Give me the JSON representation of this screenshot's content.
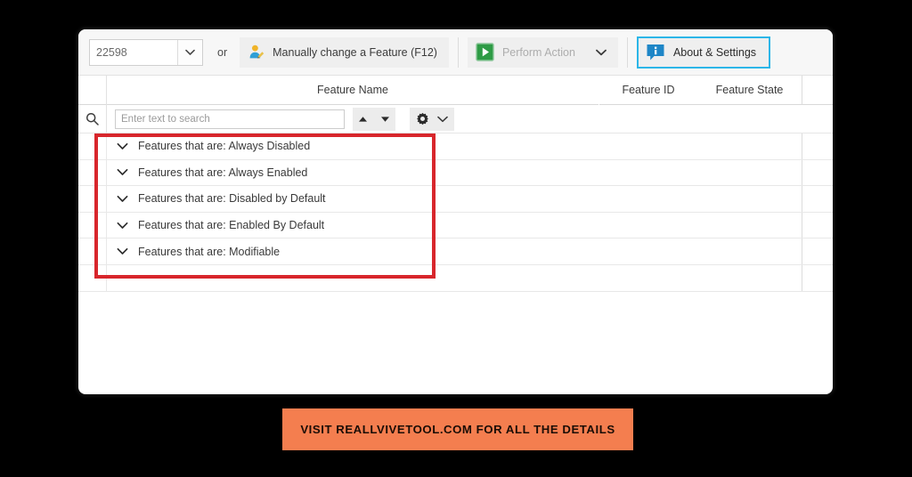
{
  "window": {
    "toolbar": {
      "build_combo": {
        "value": "22598",
        "icon": "chevron-down-icon"
      },
      "or_label": "or",
      "manual_change_button": {
        "label": "Manually change a Feature (F12)",
        "icon": "user-edit-icon"
      },
      "perform_action_button": {
        "label": "Perform Action",
        "icon": "play-icon",
        "dropdown_icon": "chevron-down-icon",
        "state": "disabled"
      },
      "about_settings_button": {
        "label": "About & Settings",
        "icon": "info-bubble-icon",
        "highlight_color": "#2cb6e8"
      }
    },
    "table": {
      "columns": [
        "Feature Name",
        "Feature ID",
        "Feature State"
      ],
      "search": {
        "icon": "search-icon",
        "placeholder": "Enter text to search",
        "value": "",
        "sort_up_icon": "triangle-up-icon",
        "sort_down_icon": "triangle-down-icon",
        "gear_icon": "gear-icon",
        "gear_dropdown_icon": "chevron-down-icon"
      },
      "rows": [
        {
          "expander": "chevron-down-icon",
          "name": "Features that are: Always Disabled",
          "id": "",
          "state": ""
        },
        {
          "expander": "chevron-down-icon",
          "name": "Features that are: Always Enabled",
          "id": "",
          "state": ""
        },
        {
          "expander": "chevron-down-icon",
          "name": "Features that are: Disabled by Default",
          "id": "",
          "state": ""
        },
        {
          "expander": "chevron-down-icon",
          "name": "Features that are: Enabled By Default",
          "id": "",
          "state": ""
        },
        {
          "expander": "chevron-down-icon",
          "name": "Features that are: Modifiable",
          "id": "",
          "state": ""
        }
      ]
    }
  },
  "annotation": {
    "highlight_color": "#d8262c"
  },
  "banner": {
    "text": "VISIT REALLVIVETOOL.COM FOR ALL THE DETAILS",
    "background_color": "#F47E4F",
    "text_color": "#1b0d06"
  }
}
